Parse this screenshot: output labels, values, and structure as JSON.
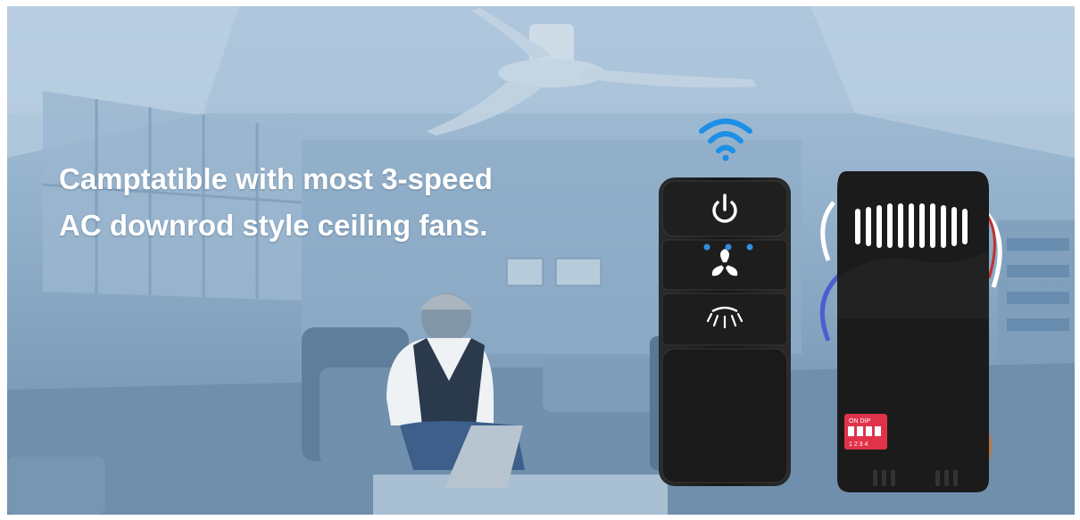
{
  "headline": {
    "line1": "Camptatible with most 3-speed",
    "line2": "AC downrod style ceiling fans."
  },
  "remote": {
    "buttons": [
      "power-icon",
      "fan-icon",
      "light-icon"
    ],
    "indicator_color": "#2f8fe0"
  },
  "receiver": {
    "dip_switch": {
      "top_label": "ON DIP",
      "numbers": "1 2 3 4"
    }
  },
  "colors": {
    "wifi": "#1e8fe6",
    "dip": "#e0334a",
    "device": "#1b1b1b"
  }
}
